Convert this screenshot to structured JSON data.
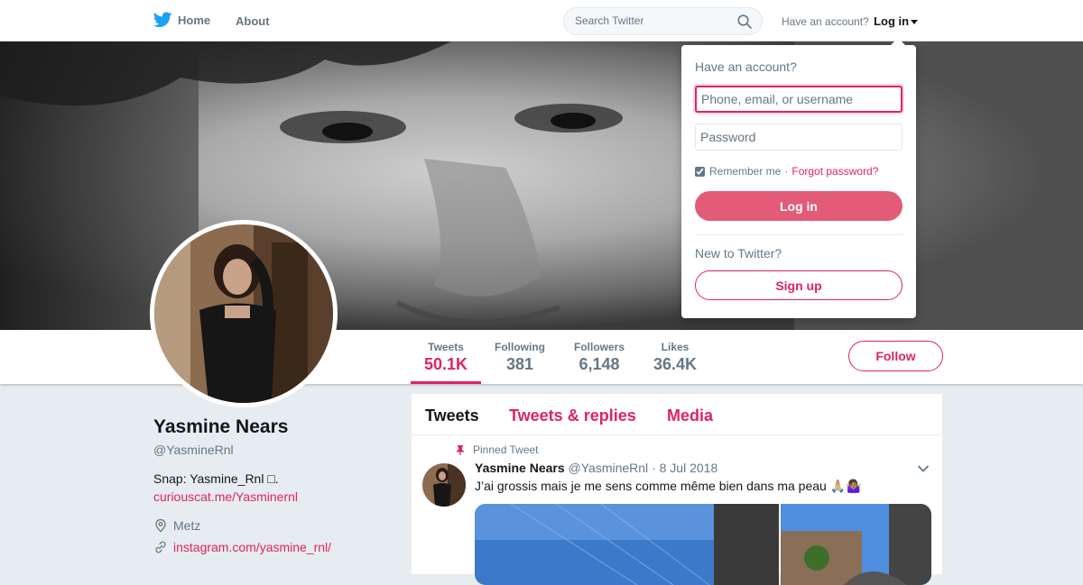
{
  "topbar": {
    "home_label": "Home",
    "about_label": "About",
    "search_placeholder": "Search Twitter",
    "have_account": "Have an account?",
    "login_label": "Log in"
  },
  "login_dropdown": {
    "title": "Have an account?",
    "username_placeholder": "Phone, email, or username",
    "password_placeholder": "Password",
    "remember_label": "Remember me",
    "separator": "·",
    "forgot_label": "Forgot password?",
    "login_button": "Log in",
    "new_label": "New to Twitter?",
    "signup_button": "Sign up"
  },
  "stats": [
    {
      "label": "Tweets",
      "value": "50.1K"
    },
    {
      "label": "Following",
      "value": "381"
    },
    {
      "label": "Followers",
      "value": "6,148"
    },
    {
      "label": "Likes",
      "value": "36.4K"
    }
  ],
  "follow_button": "Follow",
  "profile": {
    "name": "Yasmine Nears",
    "handle": "@YasmineRnl",
    "bio_text": "Snap: Yasmine_Rnl □.",
    "bio_link": "curiouscat.me/Yasminernl",
    "location": "Metz",
    "website": "instagram.com/yasmine_rnl/"
  },
  "timeline": {
    "tabs": [
      "Tweets",
      "Tweets & replies",
      "Media"
    ],
    "pinned_label": "Pinned Tweet",
    "tweet": {
      "author": "Yasmine Nears",
      "handle": "@YasmineRnl",
      "separator": "·",
      "date": "8 Jul 2018",
      "text": "J’ai grossis mais je me sens comme même  bien dans ma peau 🙏🏼🤷🏽‍♀️"
    }
  },
  "colors": {
    "accent": "#e0245e",
    "login_button": "#e35b78",
    "twitter_blue": "#1da1f2"
  },
  "icons": {
    "logo": "twitter-bird-icon",
    "search": "search-icon",
    "location": "location-pin-icon",
    "link": "link-icon",
    "pin": "pin-icon"
  }
}
